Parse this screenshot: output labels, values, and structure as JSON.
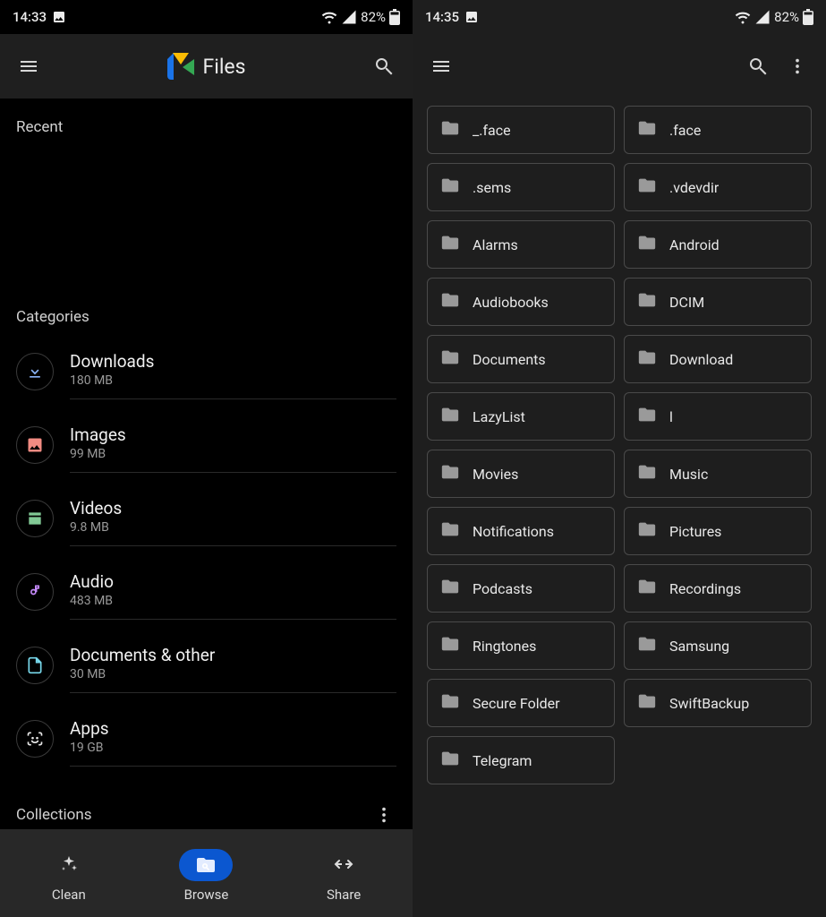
{
  "left": {
    "status": {
      "time": "14:33",
      "battery": "82%"
    },
    "appbar": {
      "title": "Files"
    },
    "sections": {
      "recent": "Recent",
      "categories": "Categories",
      "collections": "Collections"
    },
    "categories": [
      {
        "name": "Downloads",
        "size": "180 MB",
        "icon": "download",
        "color": "#8ab4f8"
      },
      {
        "name": "Images",
        "size": "99 MB",
        "icon": "image",
        "color": "#f28b82"
      },
      {
        "name": "Videos",
        "size": "9.8 MB",
        "icon": "video",
        "color": "#81c995"
      },
      {
        "name": "Audio",
        "size": "483 MB",
        "icon": "audio",
        "color": "#c58af9"
      },
      {
        "name": "Documents & other",
        "size": "30 MB",
        "icon": "document",
        "color": "#78d9ec"
      },
      {
        "name": "Apps",
        "size": "19 GB",
        "icon": "apps",
        "color": "#e8e8e8"
      }
    ],
    "nav": [
      {
        "label": "Clean",
        "icon": "sparkle",
        "active": false
      },
      {
        "label": "Browse",
        "icon": "browse",
        "active": true
      },
      {
        "label": "Share",
        "icon": "share",
        "active": false
      }
    ]
  },
  "right": {
    "status": {
      "time": "14:35",
      "battery": "82%"
    },
    "folders": [
      "_.face",
      ".face",
      ".sems",
      ".vdevdir",
      "Alarms",
      "Android",
      "Audiobooks",
      "DCIM",
      "Documents",
      "Download",
      "LazyList",
      "l",
      "Movies",
      "Music",
      "Notifications",
      "Pictures",
      "Podcasts",
      "Recordings",
      "Ringtones",
      "Samsung",
      "Secure Folder",
      "SwiftBackup",
      "Telegram"
    ]
  }
}
